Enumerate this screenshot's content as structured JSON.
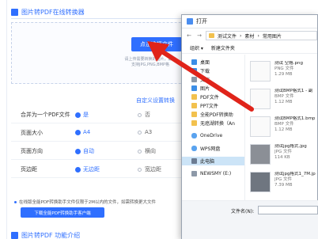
{
  "web": {
    "title": "图片转PDF在线转换器",
    "upload_button": "点击选择文件",
    "upload_hint_1": "请上传需要转换的图片，最多",
    "upload_hint_2": "支持JPG,PNG,BMP格",
    "settings_link": "自定义设置转换",
    "settings": [
      {
        "label": "合并为一个PDF文件",
        "opt1": "是",
        "opt2": "否"
      },
      {
        "label": "页面大小",
        "opt1": "A4",
        "opt2": "A3"
      },
      {
        "label": "页面方向",
        "opt1": "自动",
        "opt2": "横向"
      },
      {
        "label": "页边距",
        "opt1": "无边距",
        "opt2": "宽边距"
      }
    ],
    "note": "在线版全能PDF转换助手文件仅限于2M以内的文件，如需转换更大文件",
    "download_button": "下载全能PDF转换助手客户端",
    "bottom_title": "图片转PDF 功能介绍"
  },
  "dialog": {
    "title": "打开",
    "back": "←",
    "forward": "→",
    "address": [
      "测试文件",
      "素材",
      "常用图片"
    ],
    "toolbar": {
      "organize": "组织 ▾",
      "new_folder": "新建文件夹"
    },
    "nav": [
      {
        "label": "桌面",
        "icon": "desktop-icon"
      },
      {
        "label": "下载",
        "icon": "download-icon"
      },
      {
        "label": "文档",
        "icon": "document-icon"
      },
      {
        "label": "图片",
        "icon": "picture-icon"
      },
      {
        "label": "PDF文件",
        "icon": "folder-icon"
      },
      {
        "label": "PPT文件",
        "icon": "folder-icon"
      },
      {
        "label": "全能PDF转换助",
        "icon": "folder-icon"
      },
      {
        "label": "无癌湖转换（An",
        "icon": "folder-icon"
      },
      {
        "label": "OneDrive",
        "icon": "cloud-icon"
      },
      {
        "label": "WPS网盘",
        "icon": "cloud-icon"
      },
      {
        "label": "此电脑",
        "icon": "computer-icon"
      },
      {
        "label": "NEWSMY (E:)",
        "icon": "drive-icon"
      }
    ],
    "files": [
      {
        "name": "测试 空格.png",
        "type": "PNG 文件",
        "size": "1.29 MB"
      },
      {
        "name": "测试BMP格式1 - 副",
        "type": "BMP 文件",
        "size": "1.12 MB"
      },
      {
        "name": "测试BMP格式1.bmp",
        "type": "BMP 文件",
        "size": "1.12 MB"
      },
      {
        "name": "测试jpg格式.jpg",
        "type": "JPG 文件",
        "size": "114 KB"
      },
      {
        "name": "测试jpg格式1_7M.jp",
        "type": "JPG 文件",
        "size": "7.39 MB"
      }
    ],
    "filename_label": "文件名(N):",
    "filename_value": ""
  }
}
